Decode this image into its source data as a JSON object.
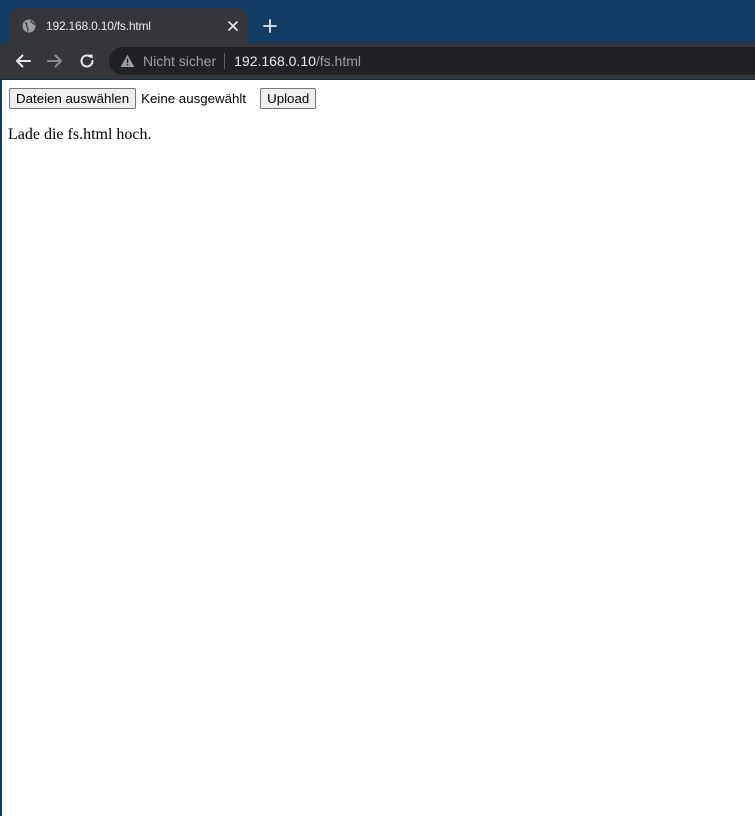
{
  "browser": {
    "tab": {
      "title": "192.168.0.10/fs.html",
      "favicon": "globe-icon"
    },
    "address_bar": {
      "security_label": "Nicht sicher",
      "host": "192.168.0.10",
      "path": "/fs.html"
    },
    "colors": {
      "tabstrip": "#113c66",
      "toolbar": "#35363a",
      "omnibox": "#202124"
    }
  },
  "page": {
    "file_input": {
      "button_label": "Dateien auswählen",
      "status": "Keine ausgewählt"
    },
    "upload_label": "Upload",
    "message": "Lade die fs.html hoch."
  }
}
